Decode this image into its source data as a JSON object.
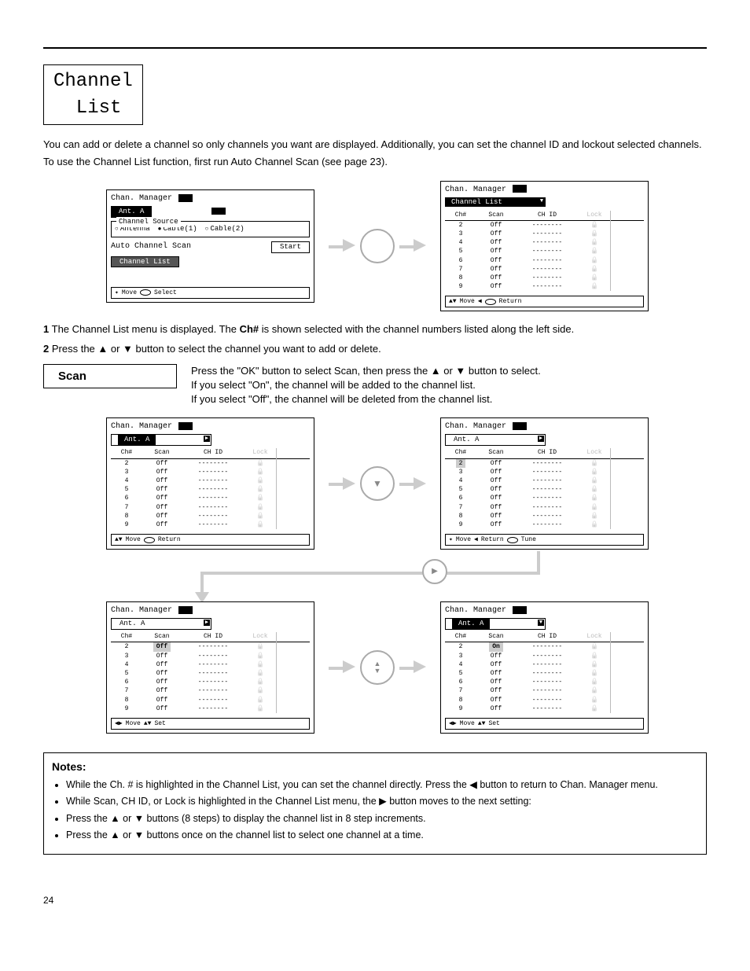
{
  "label_box": "Channel\n List",
  "intro": [
    "You can add or delete a channel so only channels you want are displayed. Additionally, you can set the channel ID and lockout selected channels.",
    "To use the Channel List function, first run Auto Channel Scan (see page 23)."
  ],
  "step1": {
    "num": "1",
    "body_prefix": "The Channel List menu is displayed. The",
    "body_bold": "Ch#",
    "body_suffix": " is shown selected with the channel numbers listed along the left side."
  },
  "panelA": {
    "title": "Chan. Manager",
    "ant": "Ant. A",
    "fieldset": "Channel Source",
    "radios": [
      "Antenna",
      "Cable(1)",
      "Cable(2)"
    ],
    "scan_label": "Auto Channel Scan",
    "scan_btn": "Start",
    "list_btn": "Channel List",
    "footer": {
      "move": "Move",
      "select": "Select",
      "diamond": "✦"
    }
  },
  "panelB": {
    "title": "Chan. Manager",
    "ant": "Channel List",
    "headers": [
      "Ch#",
      "Scan",
      "CH ID",
      "Lock"
    ],
    "rows": [
      {
        "ch": "2",
        "scan": "Off",
        "id": "--------"
      },
      {
        "ch": "3",
        "scan": "Off",
        "id": "--------"
      },
      {
        "ch": "4",
        "scan": "Off",
        "id": "--------"
      },
      {
        "ch": "5",
        "scan": "Off",
        "id": "--------"
      },
      {
        "ch": "6",
        "scan": "Off",
        "id": "--------"
      },
      {
        "ch": "7",
        "scan": "Off",
        "id": "--------"
      },
      {
        "ch": "8",
        "scan": "Off",
        "id": "--------"
      },
      {
        "ch": "9",
        "scan": "Off",
        "id": "--------"
      }
    ],
    "footer": {
      "move": "Move",
      "return": "Return"
    }
  },
  "step2": {
    "num": "2",
    "body": "Press the ▲ or ▼ button to select the channel you want to add or delete."
  },
  "sub_scan": {
    "title": "Scan",
    "lines": [
      "Press the \"OK\" button to select Scan, then press the ▲ or ▼ button to select.",
      "If you select \"On\", the channel will be added to the channel list.",
      "If you select \"Off\", the channel will be deleted from the channel list."
    ]
  },
  "panelC": {
    "title": "Chan. Manager",
    "ant": "Ant. A",
    "headers": [
      "Ch#",
      "Scan",
      "CH ID",
      "Lock"
    ],
    "rows": [
      {
        "ch": "2",
        "scan": "Off",
        "id": "--------"
      },
      {
        "ch": "3",
        "scan": "Off",
        "id": "--------"
      },
      {
        "ch": "4",
        "scan": "Off",
        "id": "--------"
      },
      {
        "ch": "5",
        "scan": "Off",
        "id": "--------"
      },
      {
        "ch": "6",
        "scan": "Off",
        "id": "--------"
      },
      {
        "ch": "7",
        "scan": "Off",
        "id": "--------"
      },
      {
        "ch": "8",
        "scan": "Off",
        "id": "--------"
      },
      {
        "ch": "9",
        "scan": "Off",
        "id": "--------"
      }
    ],
    "footer": {
      "move": "Move",
      "return": "Return"
    }
  },
  "panelD": {
    "title": "Chan. Manager",
    "ant": "Ant. A",
    "headers": [
      "Ch#",
      "Scan",
      "CH ID",
      "Lock"
    ],
    "hi_row": 0,
    "rows": [
      {
        "ch": "2",
        "scan": "Off",
        "id": "--------"
      },
      {
        "ch": "3",
        "scan": "Off",
        "id": "--------"
      },
      {
        "ch": "4",
        "scan": "Off",
        "id": "--------"
      },
      {
        "ch": "5",
        "scan": "Off",
        "id": "--------"
      },
      {
        "ch": "6",
        "scan": "Off",
        "id": "--------"
      },
      {
        "ch": "7",
        "scan": "Off",
        "id": "--------"
      },
      {
        "ch": "8",
        "scan": "Off",
        "id": "--------"
      },
      {
        "ch": "9",
        "scan": "Off",
        "id": "--------"
      }
    ],
    "footer": {
      "move": "Move",
      "return": "Return",
      "tune": "Tune",
      "arrows": "✦",
      "left_sym": "◀"
    }
  },
  "panelE": {
    "title": "Chan. Manager",
    "ant": "Ant. A",
    "headers": [
      "Ch#",
      "Scan",
      "CH ID",
      "Lock"
    ],
    "hi_scan": 0,
    "rows": [
      {
        "ch": "2",
        "scan": "Off",
        "id": "--------"
      },
      {
        "ch": "3",
        "scan": "Off",
        "id": "--------"
      },
      {
        "ch": "4",
        "scan": "Off",
        "id": "--------"
      },
      {
        "ch": "5",
        "scan": "Off",
        "id": "--------"
      },
      {
        "ch": "6",
        "scan": "Off",
        "id": "--------"
      },
      {
        "ch": "7",
        "scan": "Off",
        "id": "--------"
      },
      {
        "ch": "8",
        "scan": "Off",
        "id": "--------"
      },
      {
        "ch": "9",
        "scan": "Off",
        "id": "--------"
      }
    ],
    "footer": {
      "move": "Move",
      "set": "Set"
    }
  },
  "panelF": {
    "title": "Chan. Manager",
    "ant": "Ant. A",
    "headers": [
      "Ch#",
      "Scan",
      "CH ID",
      "Lock"
    ],
    "hi_scan": 0,
    "rows": [
      {
        "ch": "2",
        "scan": "On",
        "id": "--------"
      },
      {
        "ch": "3",
        "scan": "Off",
        "id": "--------"
      },
      {
        "ch": "4",
        "scan": "Off",
        "id": "--------"
      },
      {
        "ch": "5",
        "scan": "Off",
        "id": "--------"
      },
      {
        "ch": "6",
        "scan": "Off",
        "id": "--------"
      },
      {
        "ch": "7",
        "scan": "Off",
        "id": "--------"
      },
      {
        "ch": "8",
        "scan": "Off",
        "id": "--------"
      },
      {
        "ch": "9",
        "scan": "Off",
        "id": "--------"
      }
    ],
    "footer": {
      "move": "Move",
      "set": "Set"
    }
  },
  "notes": {
    "title": "Notes:",
    "items": [
      "While the Ch. # is highlighted in the Channel List, you can set the channel directly. Press the ◀ button to return to Chan. Manager menu.",
      "While Scan, CH ID, or Lock is highlighted in the Channel List menu, the ▶ button moves to the next setting:",
      "Press the ▲ or ▼ buttons (8 steps) to display the channel list in 8 step increments.",
      "Press the ▲ or ▼ buttons once on the channel list to select one channel at a time."
    ]
  },
  "page_num": "24",
  "misc": {
    "up": "▲",
    "down": "▼",
    "left": "◀",
    "right": "▶",
    "diamond": "✦",
    "lr": "◀▶",
    "ud": "▲▼"
  }
}
